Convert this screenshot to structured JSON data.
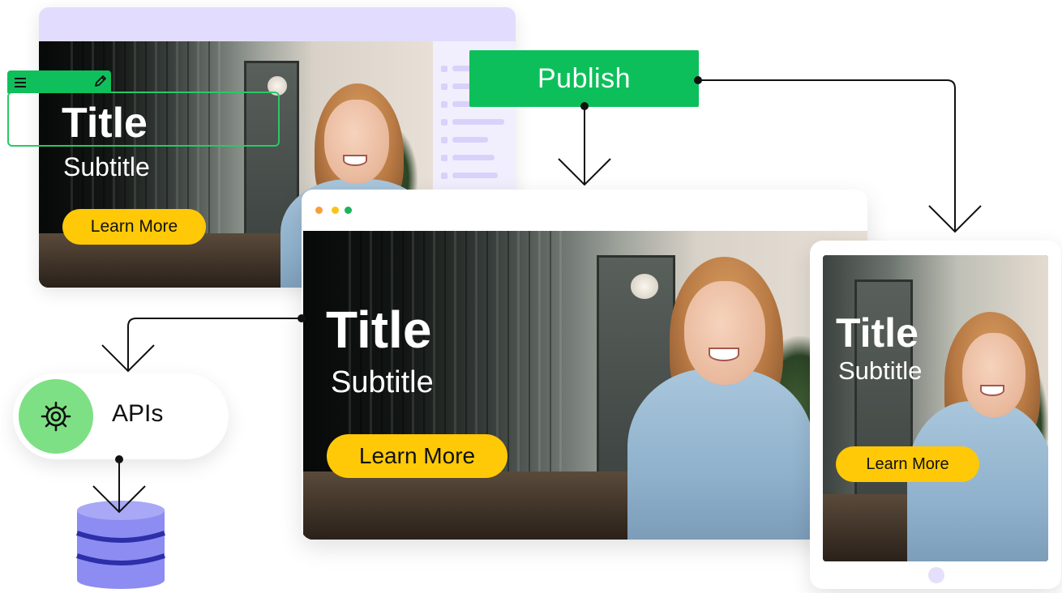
{
  "editor": {
    "title": "Title",
    "subtitle": "Subtitle",
    "button_label": "Learn More",
    "toolbar": {
      "menu_icon": "hamburger-menu-icon",
      "edit_icon": "pencil-icon"
    }
  },
  "publish": {
    "label": "Publish"
  },
  "desktop": {
    "title": "Title",
    "subtitle": "Subtitle",
    "button_label": "Learn More",
    "window_dots": [
      "#f79f3a",
      "#f7c518",
      "#1bb35c"
    ]
  },
  "tablet": {
    "title": "Title",
    "subtitle": "Subtitle",
    "button_label": "Learn More"
  },
  "apis": {
    "label": "APIs",
    "icon": "gear-icon"
  },
  "database": {
    "icon": "database-icon"
  },
  "colors": {
    "accent_green": "#0dbf5a",
    "button_yellow": "#ffc907",
    "lavender": "#e2dcff",
    "database_purple": "#8c8cf2",
    "database_band": "#2d2fa8"
  }
}
